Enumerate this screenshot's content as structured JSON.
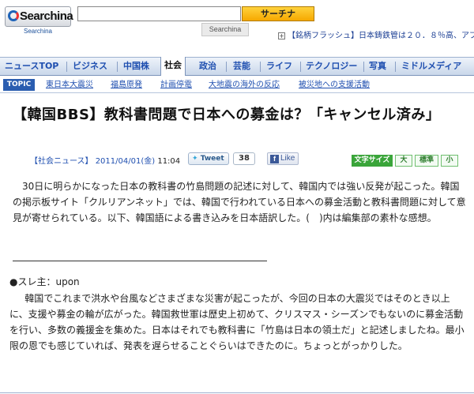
{
  "header": {
    "logo_text": "Searchina",
    "logo_sub": "Searchina",
    "search_placeholder": "",
    "search_button": "サーチナ",
    "flash_ticker": "【銘柄フラッシュ】日本鋳鉄管は２０．８％高、アプ"
  },
  "nav": {
    "items": [
      {
        "label": "ニュースTOP"
      },
      {
        "label": "ビジネス"
      },
      {
        "label": "中国株"
      },
      {
        "label": "社会"
      },
      {
        "label": "政治"
      },
      {
        "label": "芸能"
      },
      {
        "label": "ライフ"
      },
      {
        "label": "テクノロジー"
      },
      {
        "label": "写真"
      },
      {
        "label": "ミドルメディア"
      }
    ],
    "active": "社会"
  },
  "topics": {
    "label": "TOPIC",
    "items": [
      {
        "label": "東日本大震災"
      },
      {
        "label": "福島原発"
      },
      {
        "label": "計画停電"
      },
      {
        "label": "大地震の海外の反応"
      },
      {
        "label": "被災地への支援活動"
      }
    ]
  },
  "article": {
    "title": "【韓国BBS】教科書問題で日本への募金は？「キャンセル済み」",
    "category": "【社会ニュース】",
    "date": "2011/04/01(金)",
    "time": "11:04",
    "tweet_label": "Tweet",
    "tweet_count": "38",
    "like_label": "Like",
    "textsize_label": "文字サイズ",
    "textsize_options": [
      "大",
      "標準",
      "小"
    ],
    "lead": "30日に明らかになった日本の教科書の竹島問題の記述に対して、韓国内では強い反発が起こった。韓国の掲示板サイト「クルリアンネット」では、韓国で行われている日本への募金活動と教科書問題に対して意見が寄せられている。以下、韓国語による書き込みを日本語訳した。(　)内は編集部の素朴な感想。"
  },
  "thread": {
    "poster": "●スレ主：upon",
    "body": "韓国でこれまで洪水や台風などさまざまな災害が起こったが、今回の日本の大震災ではそのとき以上に、支援や募金の輪が広がった。韓国救世軍は歴史上初めて、クリスマス・シーズンでもないのに募金活動を行い、多数の義援金を集めた。日本はそれでも教科書に「竹島は日本の領土だ」と記述しましたね。最小限の恩でも感じていれば、発表を遅らせることぐらいはできたのに。ちょっとがっかりした。"
  }
}
